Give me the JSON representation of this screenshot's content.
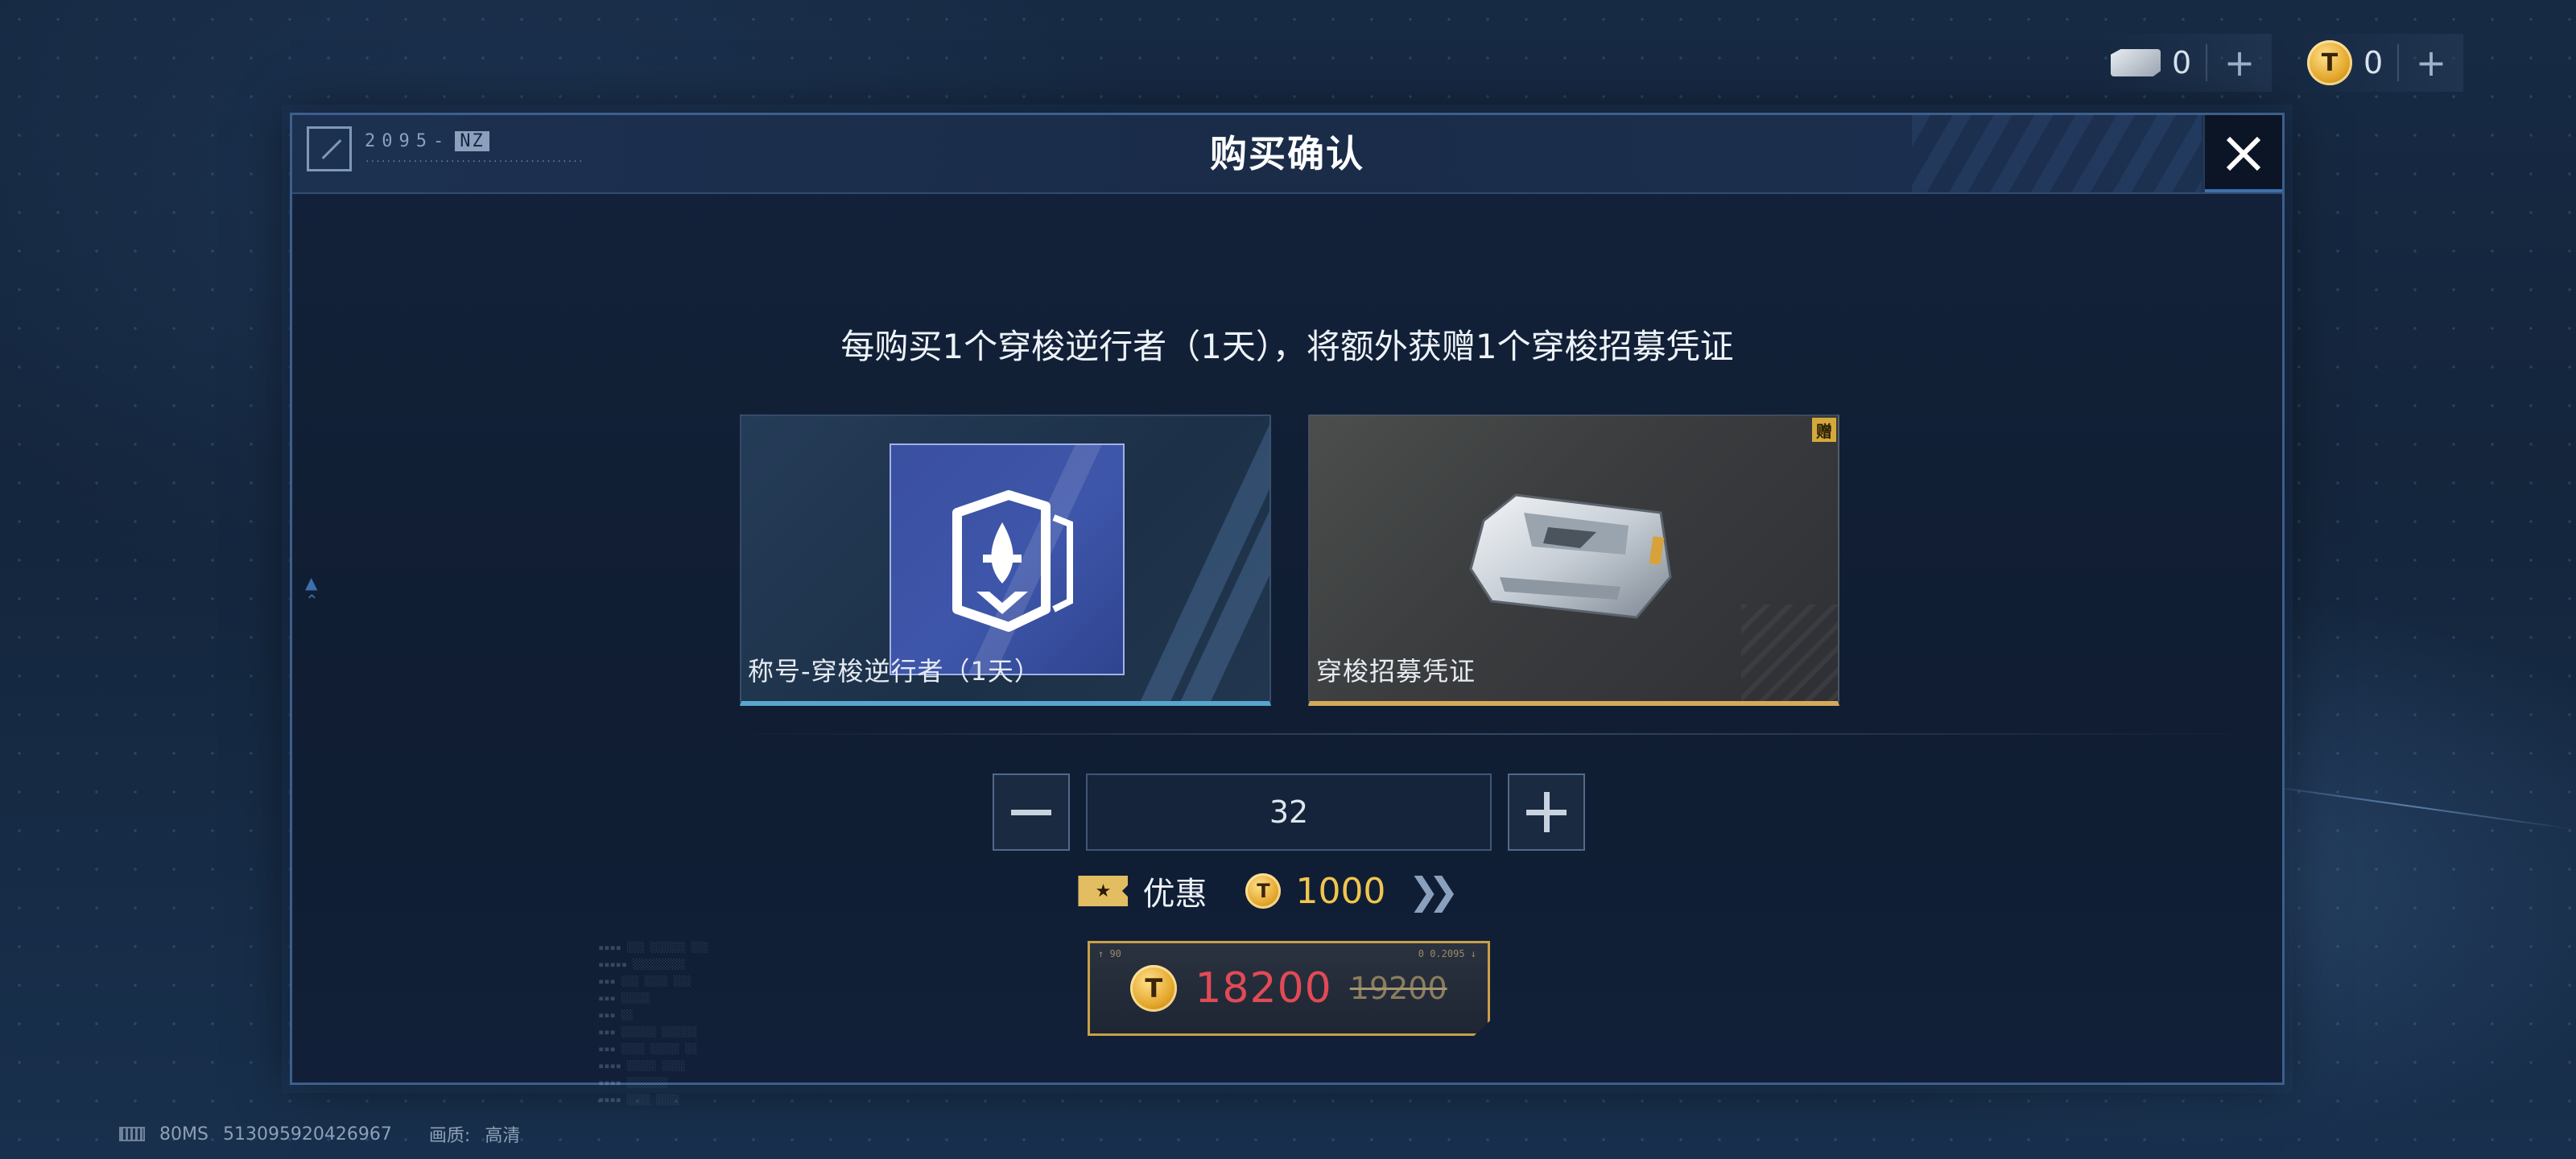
{
  "currencies": [
    {
      "icon": "ticket-icon",
      "value": "0",
      "plus": "+"
    },
    {
      "icon": "coin-icon",
      "value": "0",
      "plus": "+"
    }
  ],
  "modal": {
    "title": "购买确认",
    "header_code": "2095-",
    "header_tag": "NZ",
    "message": "每购买1个穿梭逆行者（1天），将额外获赠1个穿梭招募凭证",
    "close_icon": "close-icon",
    "items": [
      {
        "title": "称号-穿梭逆行者（1天）",
        "icon": "title-badge-icon",
        "accent": "#58a6cf"
      },
      {
        "title": "穿梭招募凭证",
        "icon": "recruit-ticket-icon",
        "accent": "#d6a95a",
        "badge": "赠"
      }
    ],
    "quantity": "32",
    "discount": {
      "tag_icon": "star-ticket-icon",
      "label": "优惠",
      "amount": "1000"
    },
    "price": {
      "current": "18200",
      "original": "19200",
      "current_color": "#e24a55"
    }
  },
  "status": {
    "latency": "80MS",
    "id": "513095920426967",
    "quality_label": "画质:",
    "quality_value": "高清"
  }
}
